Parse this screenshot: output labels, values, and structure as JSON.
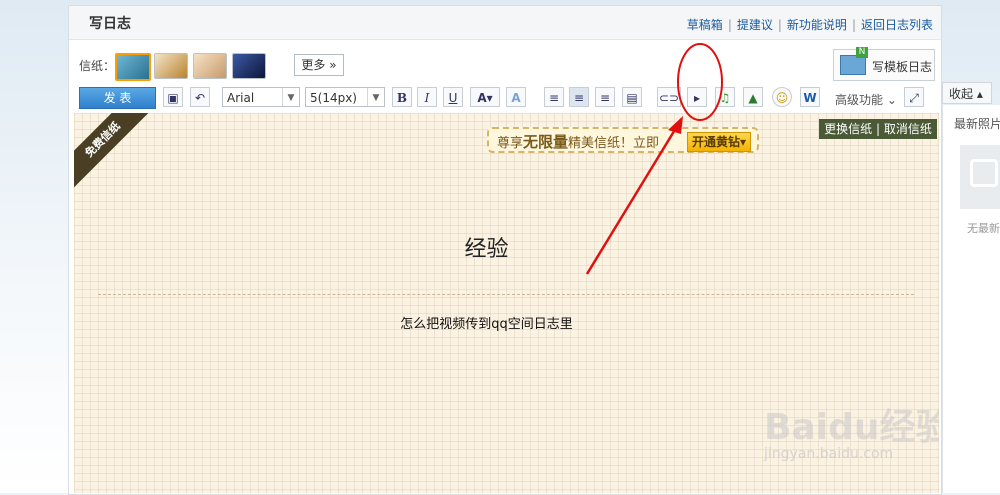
{
  "header": {
    "title": "写日志",
    "links": [
      "草稿箱",
      "提建议",
      "新功能说明",
      "返回日志列表"
    ]
  },
  "paper_row": {
    "label": "信纸：",
    "more": "更多",
    "template_button": "写模板日志",
    "template_badge": "N"
  },
  "toolbar": {
    "publish": "发 表",
    "font_family": "Arial",
    "font_size": "5(14px)",
    "bold": "B",
    "italic": "I",
    "underline": "U",
    "font_color": "A",
    "advanced": "高级功能"
  },
  "side": {
    "collapse": "收起",
    "latest_photos": "最新照片",
    "no_photos": "无最新"
  },
  "content": {
    "ribbon": "免费信纸",
    "promo_prefix": "尊享",
    "promo_big": "无限量",
    "promo_suffix": "精美信纸！立即",
    "promo_vip": "开通黄钻",
    "change_paper": "更换信纸",
    "cancel_paper": "取消信纸",
    "post_title": "经验",
    "post_body": "怎么把视频传到qq空间日志里"
  },
  "watermark": {
    "text": "Baidu经验",
    "url": "jingyan.baidu.com"
  },
  "colors": {
    "accent": "#2f7fcc",
    "annotation": "#e01010",
    "paper_bg": "#faf2e3"
  }
}
